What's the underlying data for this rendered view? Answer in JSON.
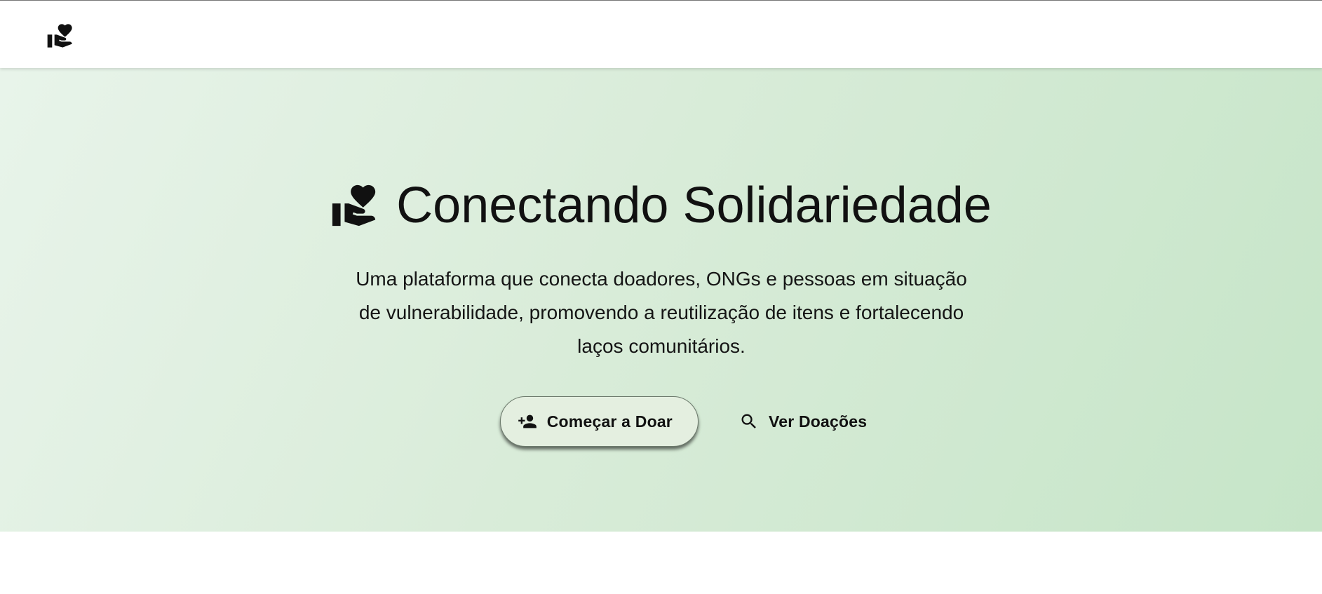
{
  "header": {
    "logo_icon": "volunteer-activism-icon"
  },
  "hero": {
    "title_icon": "volunteer-activism-icon",
    "title": "Conectando Solidariedade",
    "description": "Uma plataforma que conecta doadores, ONGs e pessoas em situação de vulnerabilidade, promovendo a reutilização de itens e fortalecendo laços comunitários.",
    "primary_button": {
      "icon": "person-add-icon",
      "label": "Começar a Doar"
    },
    "secondary_button": {
      "icon": "search-icon",
      "label": "Ver Doações"
    }
  },
  "colors": {
    "hero_gradient_start": "#e8f4ea",
    "hero_gradient_end": "#c6e5c8",
    "primary_button_bg": "#e4efe0",
    "text": "#111111"
  }
}
